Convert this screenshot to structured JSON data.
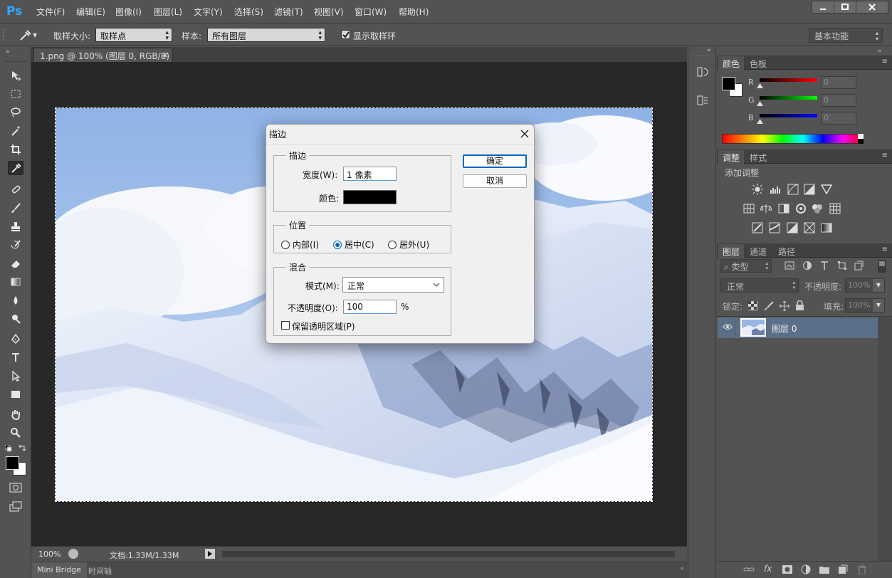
{
  "app": {
    "logo": "Ps",
    "menus": [
      "文件(F)",
      "编辑(E)",
      "图像(I)",
      "图层(L)",
      "文字(Y)",
      "选择(S)",
      "滤镜(T)",
      "视图(V)",
      "窗口(W)",
      "帮助(H)"
    ]
  },
  "options": {
    "sample_size_label": "取样大小:",
    "sample_size_value": "取样点",
    "sample_label": "样本:",
    "sample_value": "所有图层",
    "show_ring_label": "显示取样环",
    "show_ring_checked": true,
    "workspace": "基本功能"
  },
  "document": {
    "tab_title": "1.png @ 100% (图层 0, RGB/8)",
    "close_glyph": "×"
  },
  "status": {
    "zoom": "100%",
    "doc_info": "文档:1.33M/1.33M"
  },
  "bottom_tabs": [
    "Mini Bridge",
    "时间轴"
  ],
  "color_panel": {
    "tabs": [
      "颜色",
      "色板"
    ],
    "channels": [
      {
        "label": "R",
        "value": "0"
      },
      {
        "label": "G",
        "value": "0"
      },
      {
        "label": "B",
        "value": "0"
      }
    ],
    "colors": {
      "foreground": "#000000",
      "background": "#ffffff"
    }
  },
  "adjustments_panel": {
    "tabs": [
      "调整",
      "样式"
    ],
    "heading": "添加调整"
  },
  "layers_panel": {
    "tabs": [
      "图层",
      "通道",
      "路径"
    ],
    "filter_label": "类型",
    "blend_mode": "正常",
    "opacity_label": "不透明度:",
    "opacity_value": "100%",
    "lock_label": "锁定:",
    "fill_label": "填充:",
    "fill_value": "100%",
    "layers": [
      {
        "name": "图层 0",
        "visible": true
      }
    ]
  },
  "dialog": {
    "title": "描边",
    "stroke_group": "描边",
    "width_label": "宽度(W):",
    "width_value": "1 像素",
    "color_label": "颜色:",
    "stroke_color": "#000000",
    "position_group": "位置",
    "positions": [
      {
        "label": "内部(I)",
        "selected": false
      },
      {
        "label": "居中(C)",
        "selected": true
      },
      {
        "label": "居外(U)",
        "selected": false
      }
    ],
    "blend_group": "混合",
    "mode_label": "模式(M):",
    "mode_value": "正常",
    "opacity_label": "不透明度(O):",
    "opacity_value": "100",
    "percent": "%",
    "preserve_label": "保留透明区域(P)",
    "preserve_checked": false,
    "ok_label": "确定",
    "cancel_label": "取消"
  },
  "accent": "#31a8ff"
}
